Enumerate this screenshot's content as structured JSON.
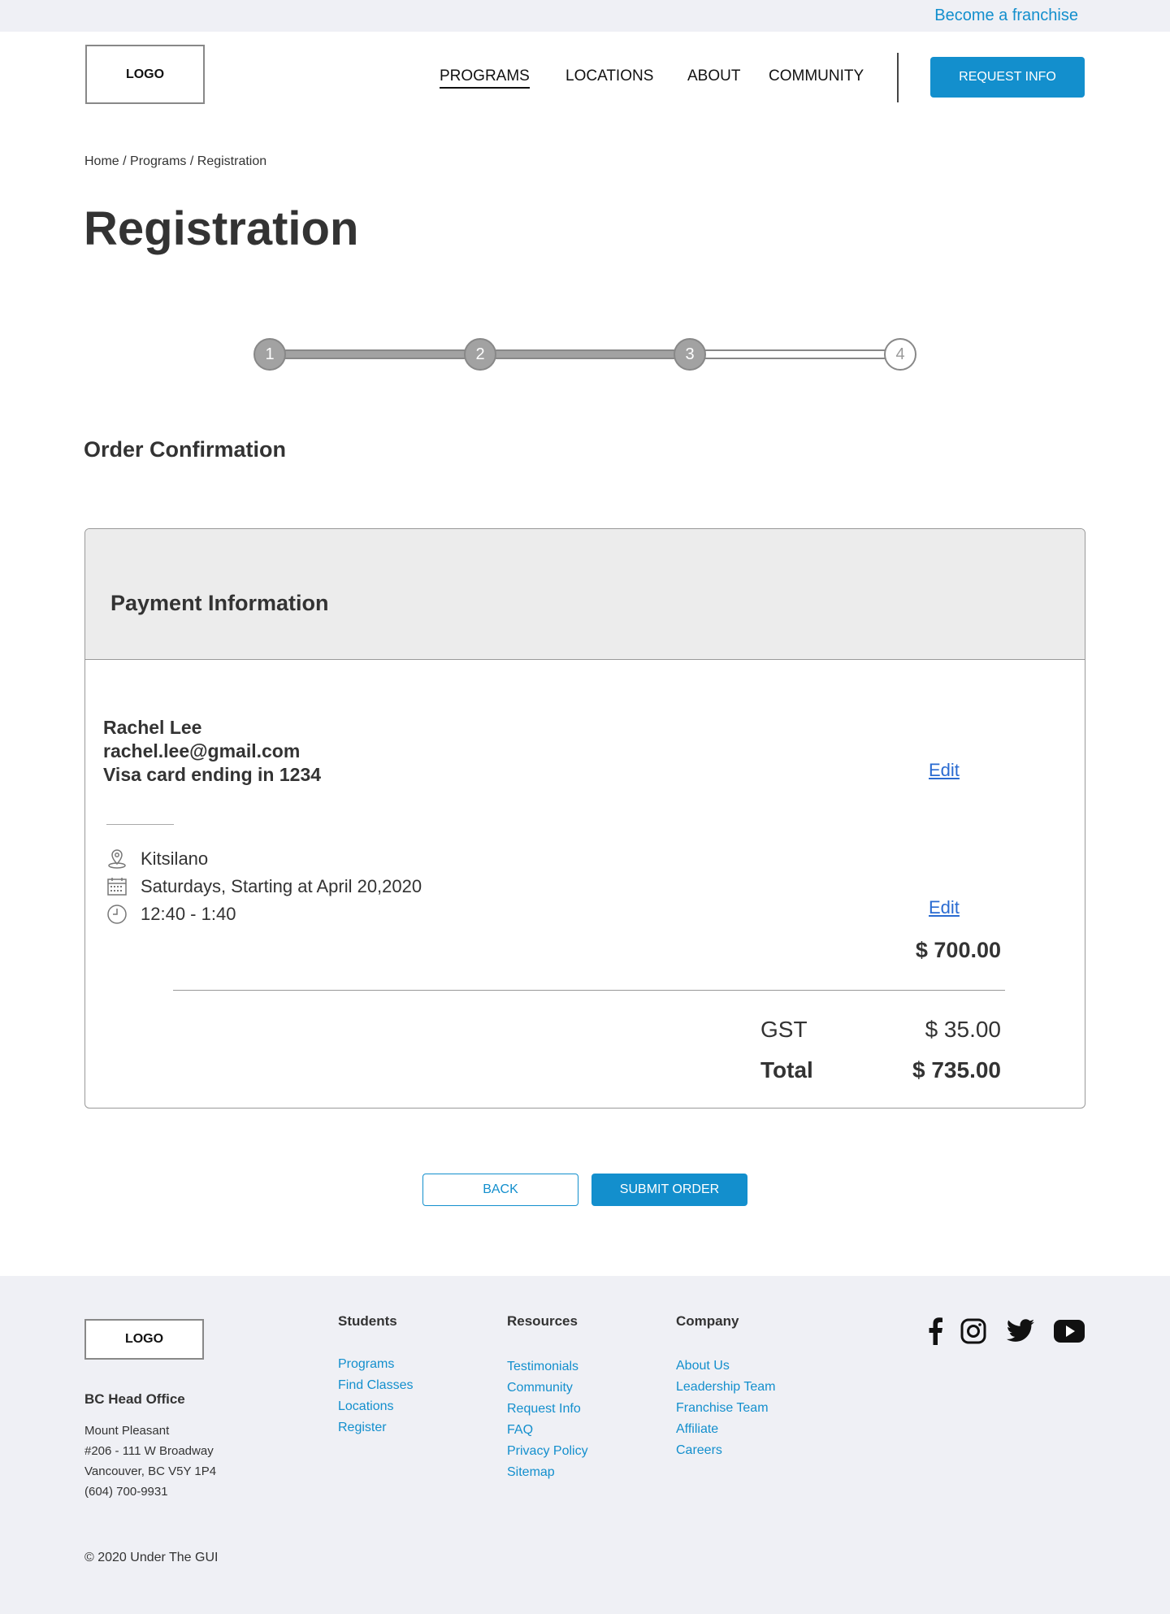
{
  "topbar": {
    "franchise_link": "Become a franchise"
  },
  "header": {
    "logo": "LOGO",
    "nav": [
      "PROGRAMS",
      "LOCATIONS",
      "ABOUT",
      "COMMUNITY"
    ],
    "request_button": "REQUEST INFO"
  },
  "breadcrumb": {
    "items": [
      "Home",
      "Programs",
      "Registration"
    ],
    "separator": "/"
  },
  "page_title": "Registration",
  "stepper": {
    "steps": [
      "1",
      "2",
      "3",
      "4"
    ],
    "current_step": 3
  },
  "section_title": "Order Confirmation",
  "payment": {
    "header": "Payment Information",
    "name": "Rachel Lee",
    "email": "rachel.lee@gmail.com",
    "card": "Visa card ending in 1234",
    "edit_label": "Edit"
  },
  "class_details": {
    "location": "Kitsilano",
    "schedule": "Saturdays, Starting at April 20,2020",
    "time": "12:40 - 1:40",
    "edit_label": "Edit",
    "subtotal": "$ 700.00"
  },
  "summary": {
    "gst_label": "GST",
    "gst_value": "$ 35.00",
    "total_label": "Total",
    "total_value": "$ 735.00"
  },
  "actions": {
    "back": "BACK",
    "submit": "SUBMIT ORDER"
  },
  "footer": {
    "logo": "LOGO",
    "office_title": "BC Head Office",
    "address": [
      "Mount Pleasant",
      "#206 - 111 W Broadway",
      "Vancouver, BC V5Y 1P4",
      "(604) 700-9931"
    ],
    "students": {
      "title": "Students",
      "links": [
        "Programs",
        "Find Classes",
        "Locations",
        "Register"
      ]
    },
    "resources": {
      "title": "Resources",
      "links": [
        "Testimonials",
        "Community",
        "Request Info",
        "FAQ",
        "Privacy Policy",
        "Sitemap"
      ]
    },
    "company": {
      "title": "Company",
      "links": [
        "About Us",
        "Leadership Team",
        "Franchise Team",
        "Affiliate",
        "Careers"
      ]
    },
    "social_icons": [
      "facebook-icon",
      "instagram-icon",
      "twitter-icon",
      "youtube-icon"
    ],
    "copyright": "© 2020 Under The GUI"
  },
  "colors": {
    "accent": "#138fcd",
    "link": "#2a6bd1",
    "step_done": "#a2a2a2",
    "panel_bg": "#ececec",
    "footer_bg": "#eff0f5"
  }
}
